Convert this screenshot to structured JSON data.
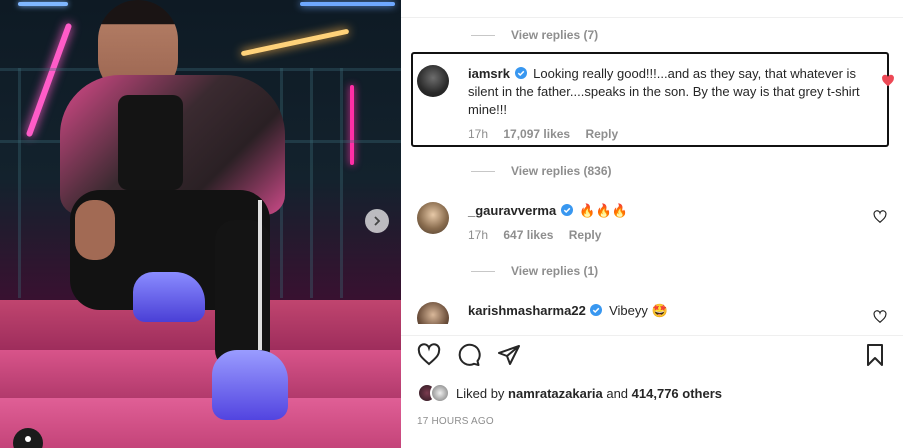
{
  "comments_section": {
    "replies_top": "View replies (7)",
    "comments": [
      {
        "username": "iamsrk",
        "text": "Looking really good!!!...and as they say, that whatever is silent in the father....speaks in the son. By the way is that grey t-shirt mine!!!",
        "time": "17h",
        "likes": "17,097 likes",
        "reply": "Reply",
        "liked": true,
        "replies": "View replies (836)"
      },
      {
        "username": "_gauravverma",
        "text": "🔥🔥🔥",
        "time": "17h",
        "likes": "647 likes",
        "reply": "Reply",
        "liked": false,
        "replies": "View replies (1)"
      },
      {
        "username": "karishmasharma22",
        "text": "Vibeyy 🤩",
        "liked": false
      }
    ]
  },
  "post_info": {
    "liked_by_prefix": "Liked by",
    "liked_by_user": "namratazakaria",
    "liked_by_and": "and",
    "liked_by_others": "414,776 others",
    "timestamp": "17 HOURS AGO"
  },
  "colors": {
    "liked_heart": "#ed4956",
    "verified": "#3897f0",
    "meta_text": "#8e8e8e",
    "highlight_border": "#111111"
  },
  "icons": {
    "heart": "heart-icon",
    "comment": "comment-icon",
    "share": "share-icon",
    "save": "bookmark-icon",
    "next": "chevron-right-icon"
  }
}
